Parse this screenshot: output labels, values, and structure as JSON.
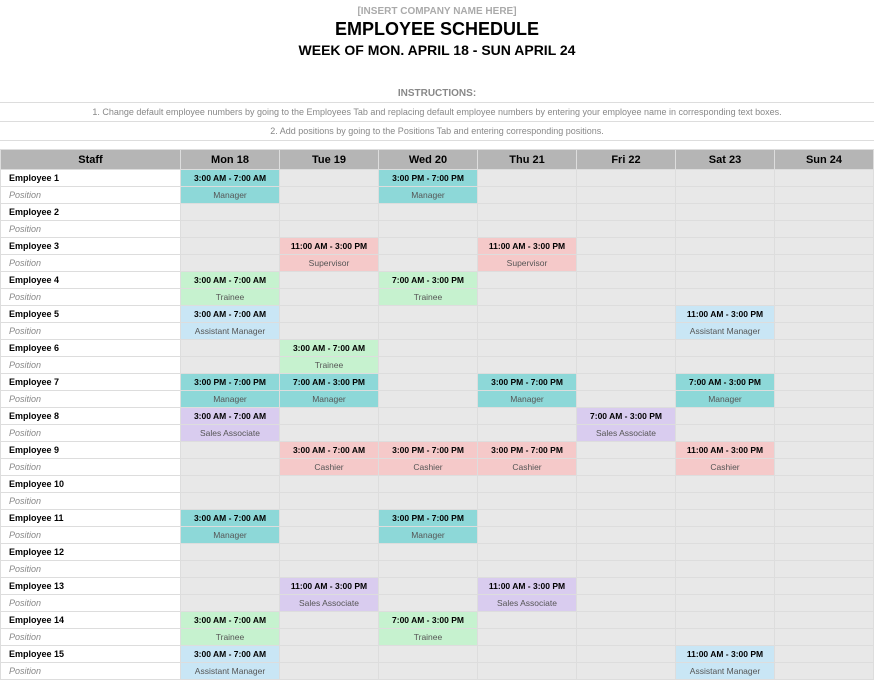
{
  "header": {
    "company": "[INSERT COMPANY NAME HERE]",
    "title": "EMPLOYEE SCHEDULE",
    "week": "WEEK OF MON. APRIL 18 - SUN APRIL 24"
  },
  "instructions": {
    "head": "INSTRUCTIONS:",
    "line1": "1. Change default employee numbers by going to the Employees Tab and replacing default employee numbers by entering your employee name in corresponding text boxes.",
    "line2": "2. Add positions by going to the Positions Tab and entering corresponding positions."
  },
  "columns": [
    "Staff",
    "Mon 18",
    "Tue 19",
    "Wed 20",
    "Thu 21",
    "Fri 22",
    "Sat 23",
    "Sun 24"
  ],
  "position_label": "Position",
  "colors": {
    "Manager_teal": "teal",
    "Manager_blue": "blue",
    "Supervisor": "pink",
    "Trainee": "green",
    "Assistant Manager": "blue",
    "Sales Associate": "purple",
    "Cashier": "pink"
  },
  "rows": [
    {
      "name": "Employee 1",
      "shifts": {
        "Mon 18": {
          "t": "3:00 AM - 7:00 AM",
          "r": "Manager",
          "c": "teal"
        },
        "Wed 20": {
          "t": "3:00 PM - 7:00 PM",
          "r": "Manager",
          "c": "teal"
        }
      }
    },
    {
      "name": "Employee 2",
      "shifts": {}
    },
    {
      "name": "Employee 3",
      "shifts": {
        "Tue 19": {
          "t": "11:00 AM - 3:00 PM",
          "r": "Supervisor",
          "c": "pink"
        },
        "Thu 21": {
          "t": "11:00 AM - 3:00 PM",
          "r": "Supervisor",
          "c": "pink"
        }
      }
    },
    {
      "name": "Employee 4",
      "shifts": {
        "Mon 18": {
          "t": "3:00 AM - 7:00 AM",
          "r": "Trainee",
          "c": "green"
        },
        "Wed 20": {
          "t": "7:00 AM - 3:00 PM",
          "r": "Trainee",
          "c": "green"
        }
      }
    },
    {
      "name": "Employee 5",
      "shifts": {
        "Mon 18": {
          "t": "3:00 AM - 7:00 AM",
          "r": "Assistant Manager",
          "c": "blue"
        },
        "Sat 23": {
          "t": "11:00 AM - 3:00 PM",
          "r": "Assistant Manager",
          "c": "blue"
        }
      }
    },
    {
      "name": "Employee 6",
      "shifts": {
        "Tue 19": {
          "t": "3:00 AM - 7:00 AM",
          "r": "Trainee",
          "c": "green"
        }
      }
    },
    {
      "name": "Employee 7",
      "shifts": {
        "Mon 18": {
          "t": "3:00 PM - 7:00 PM",
          "r": "Manager",
          "c": "teal"
        },
        "Tue 19": {
          "t": "7:00 AM - 3:00 PM",
          "r": "Manager",
          "c": "teal"
        },
        "Thu 21": {
          "t": "3:00 PM - 7:00 PM",
          "r": "Manager",
          "c": "teal"
        },
        "Sat 23": {
          "t": "7:00 AM - 3:00 PM",
          "r": "Manager",
          "c": "teal"
        }
      }
    },
    {
      "name": "Employee 8",
      "shifts": {
        "Mon 18": {
          "t": "3:00 AM - 7:00 AM",
          "r": "Sales Associate",
          "c": "purple"
        },
        "Fri 22": {
          "t": "7:00 AM - 3:00 PM",
          "r": "Sales Associate",
          "c": "purple"
        }
      }
    },
    {
      "name": "Employee 9",
      "shifts": {
        "Tue 19": {
          "t": "3:00 AM - 7:00 AM",
          "r": "Cashier",
          "c": "pink"
        },
        "Wed 20": {
          "t": "3:00 PM - 7:00 PM",
          "r": "Cashier",
          "c": "pink"
        },
        "Thu 21": {
          "t": "3:00 PM - 7:00 PM",
          "r": "Cashier",
          "c": "pink"
        },
        "Sat 23": {
          "t": "11:00 AM - 3:00 PM",
          "r": "Cashier",
          "c": "pink"
        }
      }
    },
    {
      "name": "Employee 10",
      "shifts": {}
    },
    {
      "name": "Employee 11",
      "shifts": {
        "Mon 18": {
          "t": "3:00 AM - 7:00 AM",
          "r": "Manager",
          "c": "teal"
        },
        "Wed 20": {
          "t": "3:00 PM - 7:00 PM",
          "r": "Manager",
          "c": "teal"
        }
      }
    },
    {
      "name": "Employee 12",
      "shifts": {}
    },
    {
      "name": "Employee 13",
      "shifts": {
        "Tue 19": {
          "t": "11:00 AM - 3:00 PM",
          "r": "Sales Associate",
          "c": "purple"
        },
        "Thu 21": {
          "t": "11:00 AM - 3:00 PM",
          "r": "Sales Associate",
          "c": "purple"
        }
      }
    },
    {
      "name": "Employee 14",
      "shifts": {
        "Mon 18": {
          "t": "3:00 AM - 7:00 AM",
          "r": "Trainee",
          "c": "green"
        },
        "Wed 20": {
          "t": "7:00 AM - 3:00 PM",
          "r": "Trainee",
          "c": "green"
        }
      }
    },
    {
      "name": "Employee 15",
      "shifts": {
        "Mon 18": {
          "t": "3:00 AM - 7:00 AM",
          "r": "Assistant Manager",
          "c": "blue"
        },
        "Sat 23": {
          "t": "11:00 AM - 3:00 PM",
          "r": "Assistant Manager",
          "c": "blue"
        }
      }
    }
  ]
}
